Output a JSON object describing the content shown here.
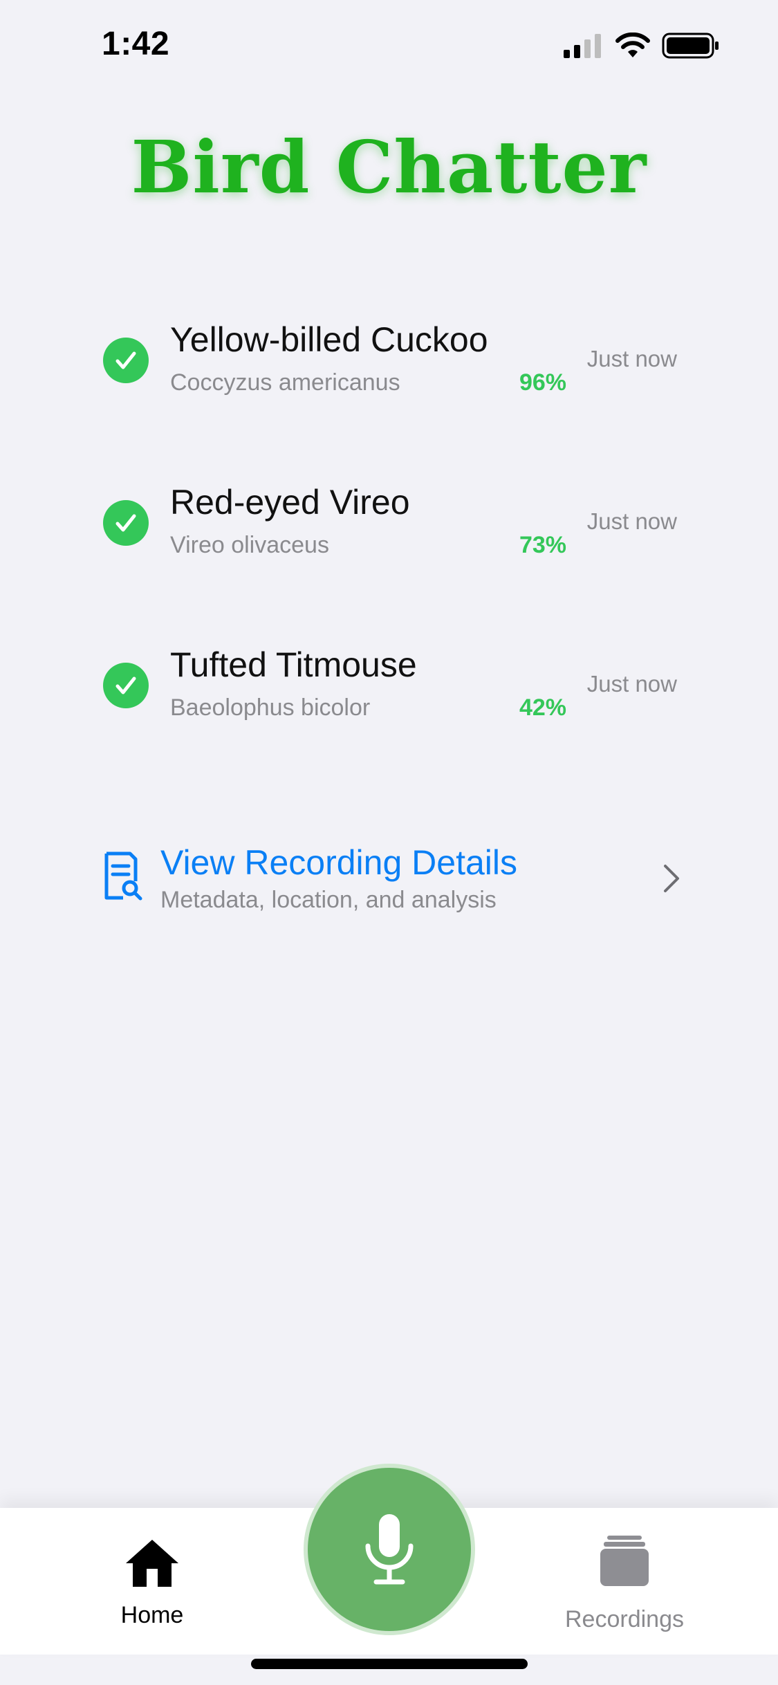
{
  "status_bar": {
    "time": "1:42"
  },
  "app": {
    "title": "Bird Chatter",
    "title_color": "#1fb21f"
  },
  "detections": [
    {
      "common_name": "Yellow-billed Cuckoo",
      "scientific_name": "Coccyzus americanus",
      "confidence": "96%",
      "time": "Just now",
      "icon": "checkmark-circle-icon"
    },
    {
      "common_name": "Red-eyed Vireo",
      "scientific_name": "Vireo olivaceus",
      "confidence": "73%",
      "time": "Just now",
      "icon": "checkmark-circle-icon"
    },
    {
      "common_name": "Tufted Titmouse",
      "scientific_name": "Baeolophus bicolor",
      "confidence": "42%",
      "time": "Just now",
      "icon": "checkmark-circle-icon"
    }
  ],
  "details_link": {
    "title": "View Recording Details",
    "subtitle": "Metadata, location, and analysis",
    "icon": "document-search-icon"
  },
  "tab_bar": {
    "home_label": "Home",
    "recordings_label": "Recordings",
    "record_icon": "microphone-icon"
  },
  "colors": {
    "accent_green": "#34c759",
    "link_blue": "#0a7ff5",
    "record_green": "#67b267",
    "background": "#f2f2f7"
  }
}
